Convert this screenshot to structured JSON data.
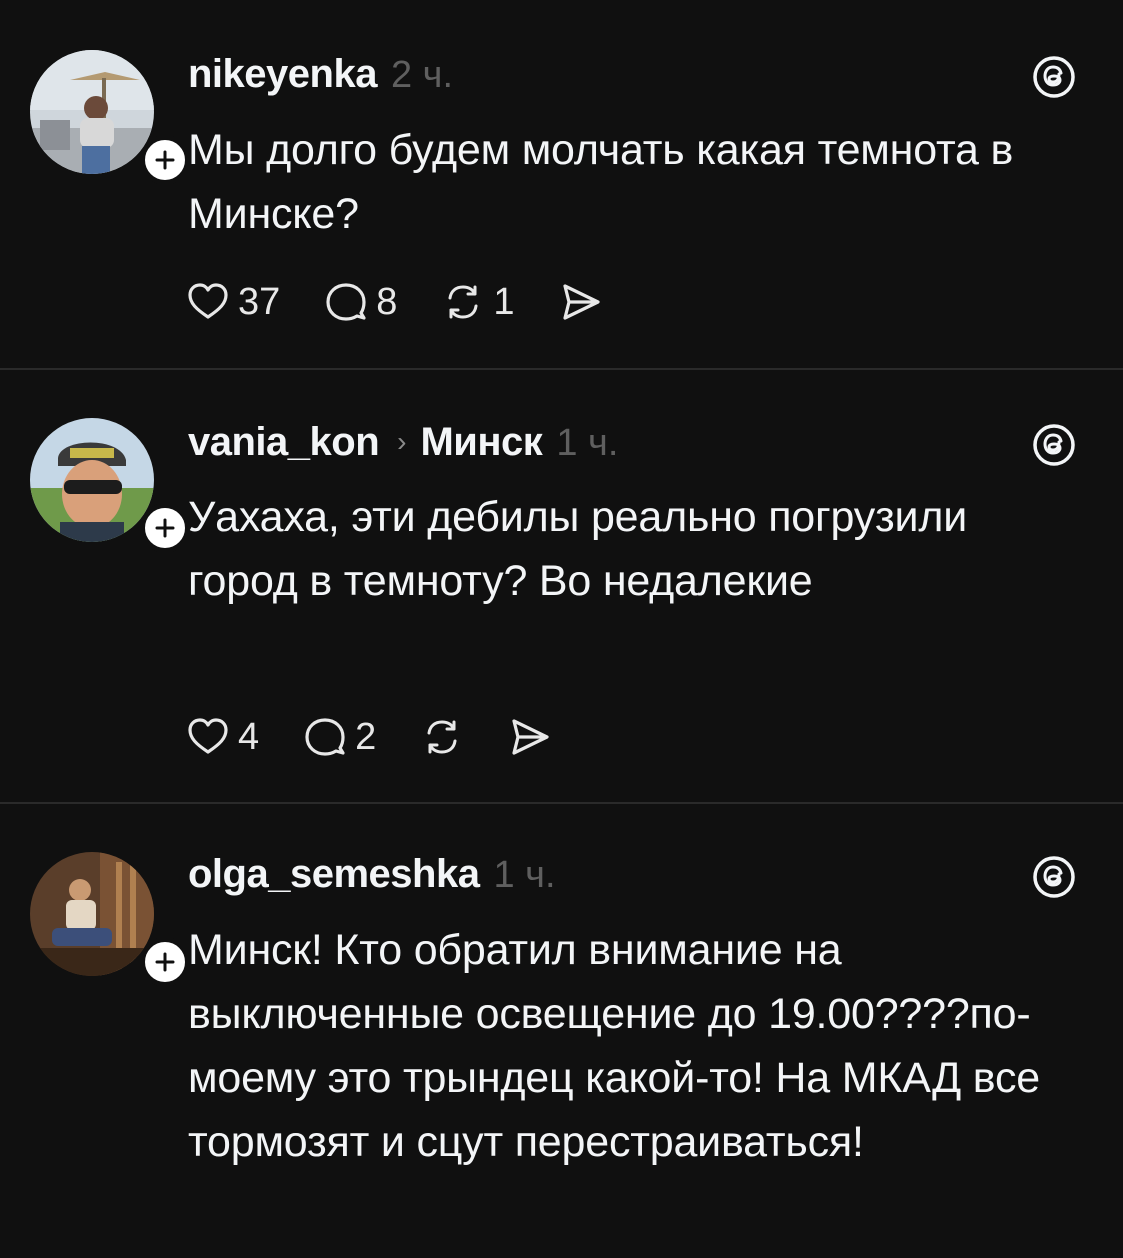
{
  "posts": [
    {
      "username": "nikeyenka",
      "time": "2 ч.",
      "text": "Мы долго будем молчать какая темнота в Минске?",
      "likes": "37",
      "replies": "8",
      "reposts": "1"
    },
    {
      "username": "vania_kon",
      "community": "Минск",
      "time": "1 ч.",
      "text": "Уахаха, эти дебилы реально погрузили город в темноту?  Во недалекие",
      "likes": "4",
      "replies": "2",
      "reposts": ""
    },
    {
      "username": "olga_semeshka",
      "time": "1 ч.",
      "text": "Минск! Кто обратил внимание на выключенные освещение до 19.00????по-моему это трындец какой-то! На МКАД все тормозят и сцут перестраиваться!"
    }
  ],
  "icons": {
    "avatar": "avatar-photo",
    "follow": "plus-icon",
    "logo": "threads-logo-icon",
    "like": "heart-icon",
    "reply": "comment-icon",
    "repost": "repost-icon",
    "share": "share-icon"
  },
  "colors": {
    "background": "#101010",
    "text": "#f3f5f7",
    "muted": "#5f5f5f",
    "divider": "#2a2a2a"
  }
}
